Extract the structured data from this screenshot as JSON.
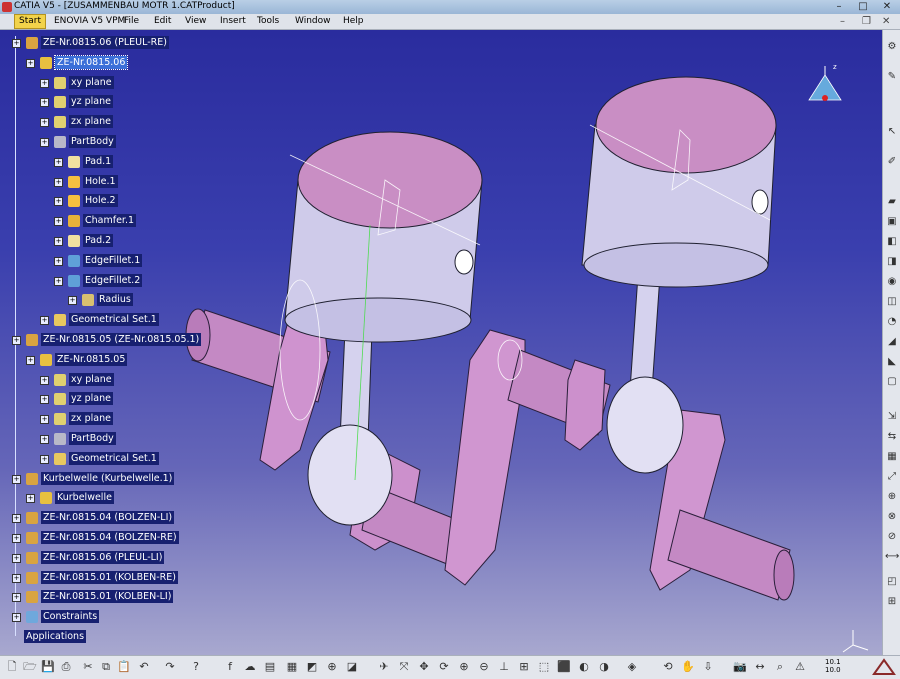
{
  "window": {
    "title": "CATIA V5 - [ZUSAMMENBAU MOTR 1.CATProduct]"
  },
  "menu": {
    "start": "Start",
    "items": [
      "ENOVIA V5 VPM",
      "File",
      "Edit",
      "View",
      "Insert",
      "Tools",
      "Window",
      "Help"
    ]
  },
  "tree": [
    {
      "label": "ZE-Nr.0815.06 (PLEUL-RE)",
      "depth": 0,
      "icon": "product-icon"
    },
    {
      "label": "ZE-Nr.0815.06",
      "depth": 1,
      "icon": "part-icon",
      "selected": true
    },
    {
      "label": "xy plane",
      "depth": 2,
      "icon": "plane-icon"
    },
    {
      "label": "yz plane",
      "depth": 2,
      "icon": "plane-icon"
    },
    {
      "label": "zx plane",
      "depth": 2,
      "icon": "plane-icon"
    },
    {
      "label": "PartBody",
      "depth": 2,
      "icon": "gear-icon"
    },
    {
      "label": "Pad.1",
      "depth": 3,
      "icon": "pad-icon"
    },
    {
      "label": "Hole.1",
      "depth": 3,
      "icon": "hole-icon"
    },
    {
      "label": "Hole.2",
      "depth": 3,
      "icon": "hole-icon"
    },
    {
      "label": "Chamfer.1",
      "depth": 3,
      "icon": "chamfer-icon"
    },
    {
      "label": "Pad.2",
      "depth": 3,
      "icon": "pad-icon"
    },
    {
      "label": "EdgeFillet.1",
      "depth": 3,
      "icon": "fillet-icon"
    },
    {
      "label": "EdgeFillet.2",
      "depth": 3,
      "icon": "fillet-icon"
    },
    {
      "label": "Radius",
      "depth": 4,
      "icon": "radius-icon"
    },
    {
      "label": "Geometrical Set.1",
      "depth": 2,
      "icon": "geoset-icon"
    },
    {
      "label": "ZE-Nr.0815.05 (ZE-Nr.0815.05.1)",
      "depth": 0,
      "icon": "product-icon"
    },
    {
      "label": "ZE-Nr.0815.05",
      "depth": 1,
      "icon": "part-icon"
    },
    {
      "label": "xy plane",
      "depth": 2,
      "icon": "plane-icon"
    },
    {
      "label": "yz plane",
      "depth": 2,
      "icon": "plane-icon"
    },
    {
      "label": "zx plane",
      "depth": 2,
      "icon": "plane-icon"
    },
    {
      "label": "PartBody",
      "depth": 2,
      "icon": "gear-icon"
    },
    {
      "label": "Geometrical Set.1",
      "depth": 2,
      "icon": "geoset-icon"
    },
    {
      "label": "Kurbelwelle (Kurbelwelle.1)",
      "depth": 0,
      "icon": "product-icon"
    },
    {
      "label": "Kurbelwelle",
      "depth": 1,
      "icon": "part-icon"
    },
    {
      "label": "ZE-Nr.0815.04 (BOLZEN-LI)",
      "depth": 0,
      "icon": "product-icon"
    },
    {
      "label": "ZE-Nr.0815.04 (BOLZEN-RE)",
      "depth": 0,
      "icon": "product-icon"
    },
    {
      "label": "ZE-Nr.0815.06 (PLEUL-LI)",
      "depth": 0,
      "icon": "product-icon"
    },
    {
      "label": "ZE-Nr.0815.01 (KOLBEN-RE)",
      "depth": 0,
      "icon": "product-icon"
    },
    {
      "label": "ZE-Nr.0815.01 (KOLBEN-LI)",
      "depth": 0,
      "icon": "product-icon"
    },
    {
      "label": "Constraints",
      "depth": 0,
      "icon": "constraints-icon"
    },
    {
      "label": "Applications",
      "depth": -1,
      "icon": "none"
    }
  ],
  "statusbar": {
    "zoom_top": "10.1",
    "zoom_bottom": "10.0"
  },
  "colors": {
    "part": "#c88bc8",
    "piston": "#c9c6ea",
    "piston_top": "#c98ec4",
    "tree_bg": "#172070",
    "selection": "#3b6fd8"
  }
}
